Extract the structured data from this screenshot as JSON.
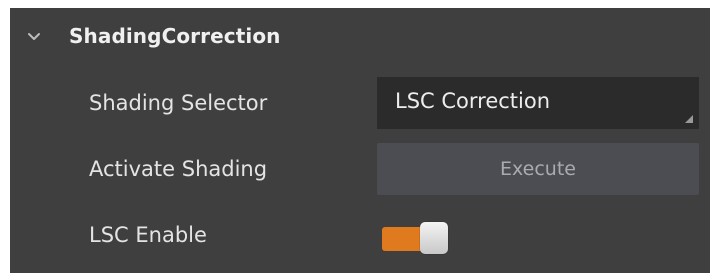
{
  "section": {
    "title": "ShadingCorrection",
    "expanded": true,
    "chevron_icon": "chevron-down-icon"
  },
  "rows": {
    "shading_selector": {
      "label": "Shading Selector",
      "value": "LSC Correction",
      "corner_icon": "dropdown-corner-icon"
    },
    "activate_shading": {
      "label": "Activate Shading",
      "button_label": "Execute"
    },
    "lsc_enable": {
      "label": "LSC Enable",
      "on": true
    }
  },
  "colors": {
    "panel_background": "#3f3f3f",
    "select_background": "#2b2b2b",
    "button_background": "#4b4d52",
    "toggle_on": "#e07a1e"
  }
}
